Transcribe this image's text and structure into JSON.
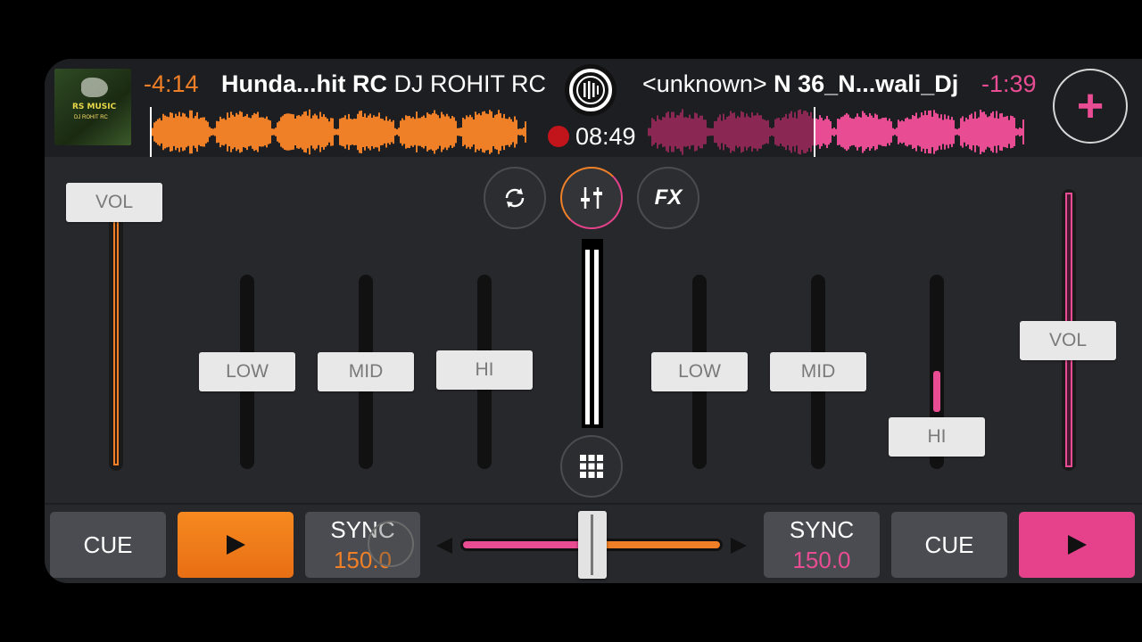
{
  "deck_left": {
    "album_art": {
      "line1": "RS MUSIC",
      "line2": "DJ ROHIT RC"
    },
    "time": "-4:14",
    "title_bold": "Hunda...hit RC",
    "artist": "DJ ROHIT RC",
    "color": "#f08027",
    "cue_label": "CUE",
    "sync_label": "SYNC",
    "bpm": "150.0",
    "vol_label": "VOL",
    "low_label": "LOW",
    "mid_label": "MID",
    "hi_label": "HI",
    "play_icon": "play-icon"
  },
  "deck_right": {
    "artist": "<unknown>",
    "title_bold": "N 36_N...wali_Dj",
    "time": "-1:39",
    "color": "#e84c93",
    "cue_label": "CUE",
    "sync_label": "SYNC",
    "bpm": "150.0",
    "vol_label": "VOL",
    "low_label": "LOW",
    "mid_label": "MID",
    "hi_label": "HI",
    "play_icon": "play-icon"
  },
  "center": {
    "clock": "08:49",
    "logo_icon": "app-logo-icon",
    "sync_icon": "refresh-icon",
    "mixer_icon": "mixer-sliders-icon",
    "fx_label": "FX",
    "grid_icon": "grid-icon",
    "add_icon": "plus-icon"
  },
  "colors": {
    "left": "#f08027",
    "right": "#e84c93",
    "background": "#27282c"
  },
  "levels": {
    "left_volume": 0.95,
    "right_volume": 0.47,
    "left_low": 0.47,
    "left_mid": 0.47,
    "left_hi": 0.47,
    "right_low": 0.47,
    "right_mid": 0.47,
    "right_hi": 0.18,
    "crossfader": 0.5
  }
}
